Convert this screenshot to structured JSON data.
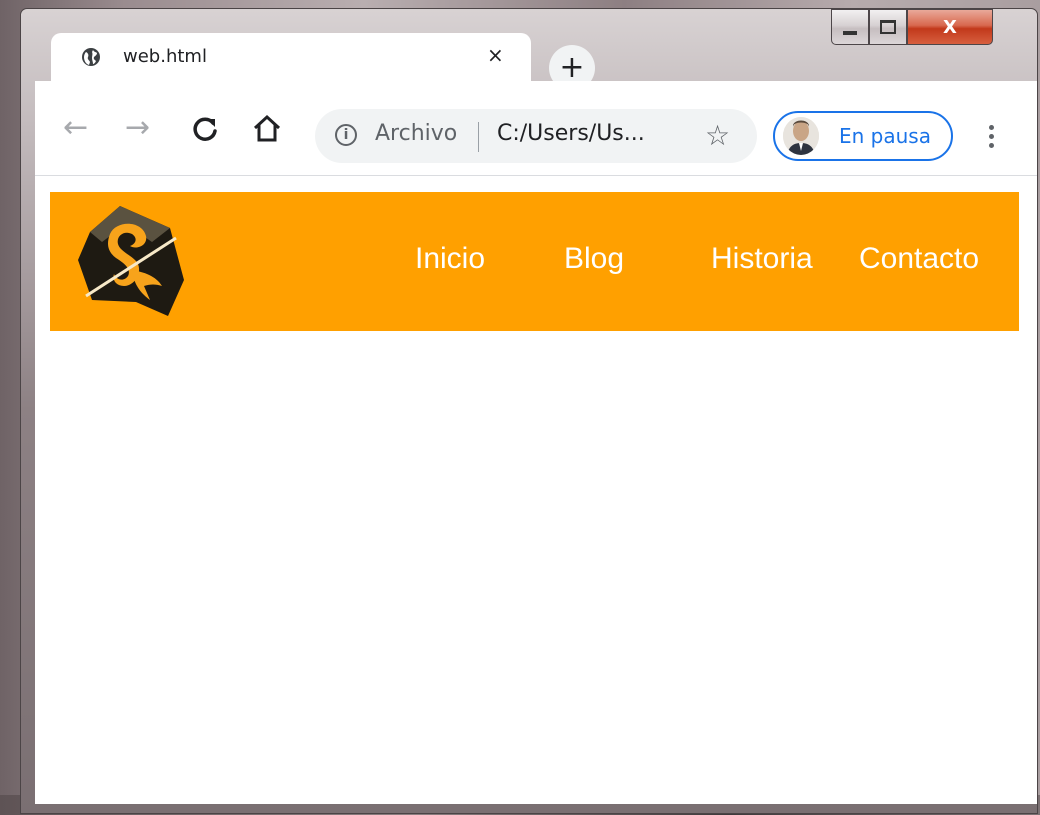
{
  "tab": {
    "title": "web.html",
    "close_glyph": "×",
    "favicon": "globe-icon"
  },
  "newtab": {
    "glyph": "+"
  },
  "window_controls": {
    "close_glyph": "X"
  },
  "toolbar": {
    "back_glyph": "←",
    "forward_glyph": "→",
    "reload_glyph": "C",
    "home_glyph": "⌂",
    "bookmark_glyph": "☆"
  },
  "omnibox": {
    "info_glyph": "i",
    "scheme_label": "Archivo",
    "url": "C:/Users/Us..."
  },
  "profile": {
    "status": "En pausa"
  },
  "site": {
    "header_color": "#ffa000",
    "nav": [
      {
        "label": "Inicio"
      },
      {
        "label": "Blog"
      },
      {
        "label": "Historia"
      },
      {
        "label": "Contacto"
      }
    ]
  }
}
